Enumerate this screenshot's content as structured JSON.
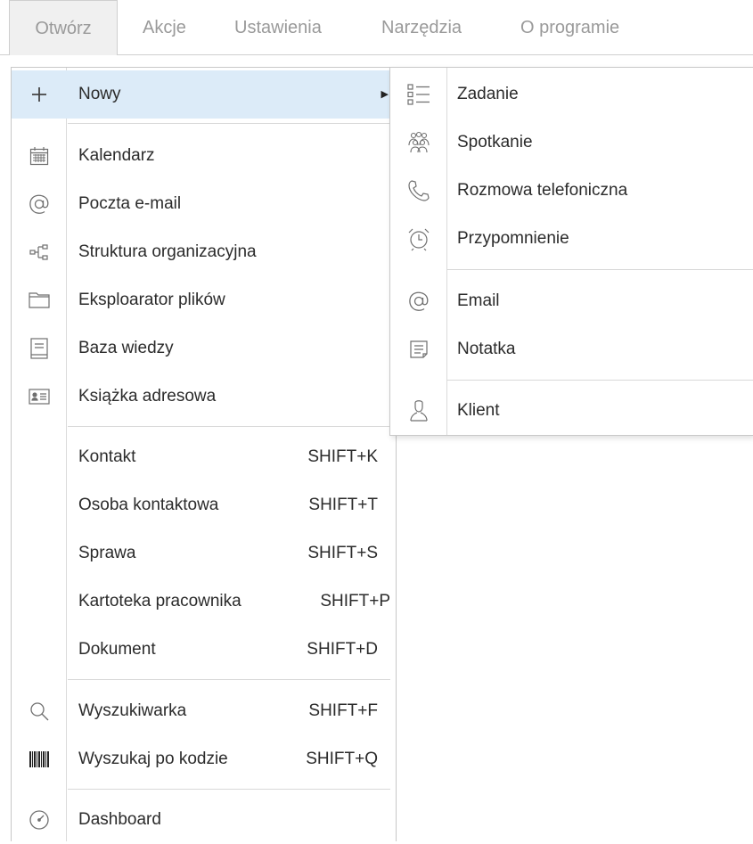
{
  "menubar": {
    "tabs": [
      {
        "label": "Otwórz"
      },
      {
        "label": "Akcje"
      },
      {
        "label": "Ustawienia"
      },
      {
        "label": "Narzędzia"
      },
      {
        "label": "O programie"
      }
    ]
  },
  "menu": {
    "new": {
      "label": "Nowy",
      "icon": "plus-icon"
    },
    "views": [
      {
        "label": "Kalendarz",
        "icon": "calendar-icon"
      },
      {
        "label": "Poczta e-mail",
        "icon": "at-icon"
      },
      {
        "label": "Struktura organizacyjna",
        "icon": "org-structure-icon"
      },
      {
        "label": "Eksploarator plików",
        "icon": "folder-icon"
      },
      {
        "label": "Baza wiedzy",
        "icon": "knowledge-base-icon"
      },
      {
        "label": "Książka adresowa",
        "icon": "address-book-icon"
      }
    ],
    "records": [
      {
        "label": "Kontakt",
        "shortcut": "SHIFT+K"
      },
      {
        "label": "Osoba kontaktowa",
        "shortcut": "SHIFT+T"
      },
      {
        "label": "Sprawa",
        "shortcut": "SHIFT+S"
      },
      {
        "label": "Kartoteka pracownika",
        "shortcut": "SHIFT+P"
      },
      {
        "label": "Dokument",
        "shortcut": "SHIFT+D"
      }
    ],
    "search": [
      {
        "label": "Wyszukiwarka",
        "shortcut": "SHIFT+F",
        "icon": "search-icon"
      },
      {
        "label": "Wyszukaj po kodzie",
        "shortcut": "SHIFT+Q",
        "icon": "barcode-icon"
      }
    ],
    "dashboard": {
      "label": "Dashboard",
      "icon": "gauge-icon"
    }
  },
  "submenu": {
    "items": [
      {
        "label": "Zadanie",
        "icon": "task-list-icon"
      },
      {
        "label": "Spotkanie",
        "icon": "people-icon"
      },
      {
        "label": "Rozmowa telefoniczna",
        "icon": "phone-icon"
      },
      {
        "label": "Przypomnienie",
        "icon": "alarm-clock-icon"
      },
      {
        "label": "Email",
        "icon": "at-icon"
      },
      {
        "label": "Notatka",
        "icon": "note-icon"
      },
      {
        "label": "Klient",
        "icon": "person-icon"
      }
    ]
  },
  "colors": {
    "highlight": "#dcebf8",
    "menubar_text": "#9a9a9a",
    "text": "#2b2b2b"
  }
}
